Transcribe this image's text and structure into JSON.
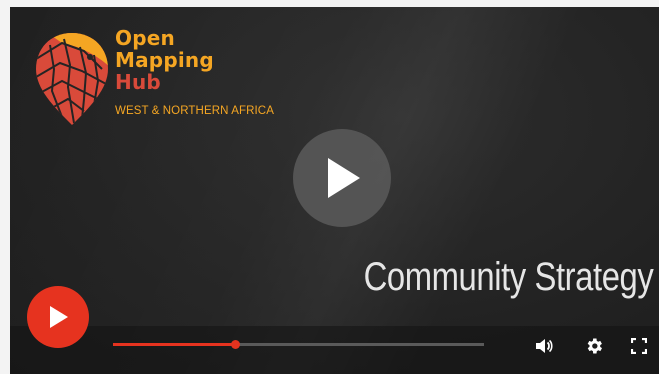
{
  "brand": {
    "line1": "Open",
    "line2": "Mapping",
    "line3": "Hub",
    "region": "WEST & NORTHERN AFRICA"
  },
  "video": {
    "title": "Community Strategy",
    "progress": 0.33
  },
  "icons": {
    "big_play": "play-icon",
    "youtube_play": "play-icon",
    "volume": "volume-icon",
    "settings": "gear-icon",
    "fullscreen": "fullscreen-icon",
    "logo": "map-pin-logo"
  },
  "colors": {
    "accent_orange": "#f5a623",
    "accent_red": "#d94a3a",
    "youtube_red": "#e6331f",
    "background": "#242424"
  }
}
